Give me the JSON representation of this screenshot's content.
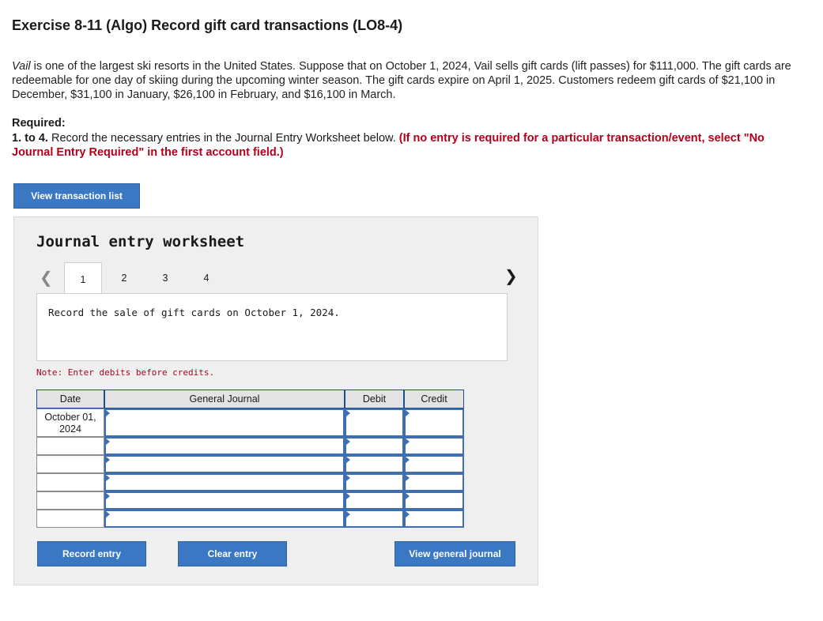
{
  "header": {
    "title": "Exercise 8-11 (Algo) Record gift card transactions (LO8-4)"
  },
  "intro": {
    "italic_lead": "Vail",
    "text": " is one of the largest ski resorts in the United States. Suppose that on October 1, 2024, Vail sells gift cards (lift passes) for $111,000. The gift cards are redeemable for one day of skiing during the upcoming winter season. The gift cards expire on April 1, 2025. Customers redeem gift cards of $21,100 in December, $31,100 in January, $26,100 in February, and $16,100 in March."
  },
  "required": {
    "label": "Required:",
    "bold_lead": "1. to 4.",
    "text": " Record the necessary entries in the Journal Entry Worksheet below. ",
    "red_note": "(If no entry is required for a particular transaction/event, select \"No Journal Entry Required\" in the first account field.)"
  },
  "buttons": {
    "view_transaction_list": "View transaction list",
    "record_entry": "Record entry",
    "clear_entry": "Clear entry",
    "view_general_journal": "View general journal"
  },
  "worksheet": {
    "title": "Journal entry worksheet",
    "tabs": [
      "1",
      "2",
      "3",
      "4"
    ],
    "active_tab": "1",
    "nav_prev_icon": "chevron-left-icon",
    "nav_next_icon": "chevron-right-icon",
    "description": "Record the sale of gift cards on October 1, 2024.",
    "note": "Note: Enter debits before credits.",
    "columns": {
      "date": "Date",
      "general_journal": "General Journal",
      "debit": "Debit",
      "credit": "Credit"
    },
    "first_row_date_line1": "October 01,",
    "first_row_date_line2": "2024"
  },
  "colors": {
    "button_blue": "#3b78c4",
    "accent_red": "#b3001b",
    "input_border": "#3f6fb0"
  }
}
